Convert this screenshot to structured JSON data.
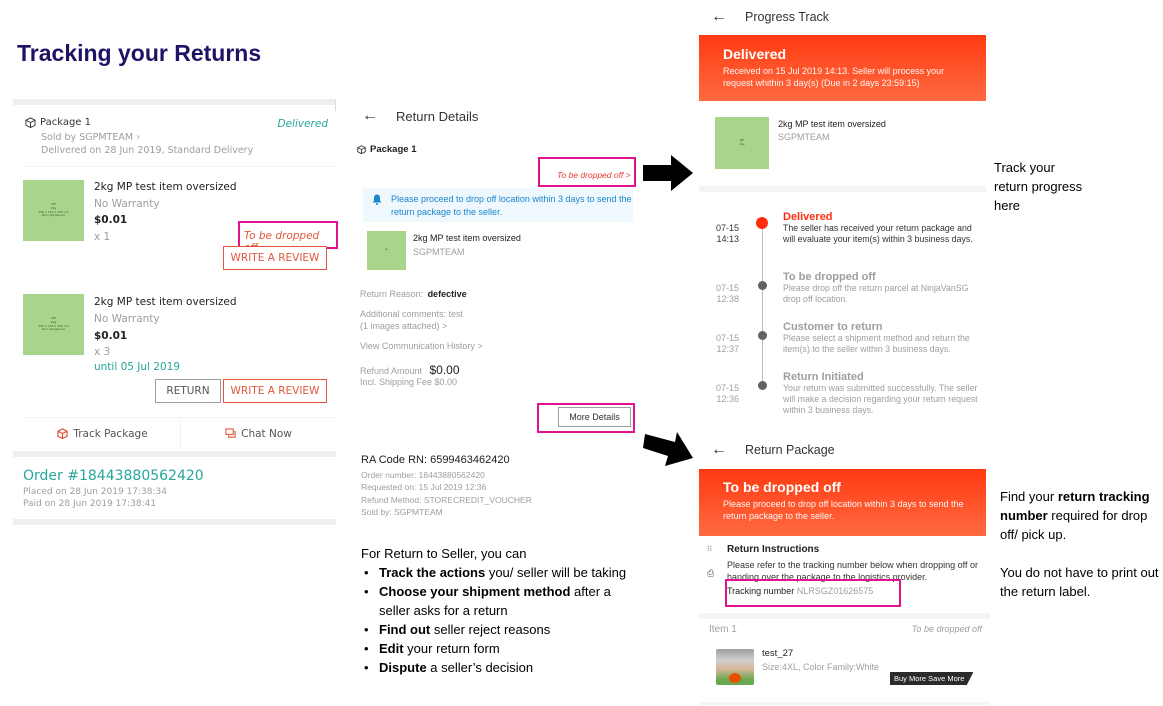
{
  "page_title": "Tracking your Returns",
  "orders_panel": {
    "package_label": "Package 1",
    "package_status": "Delivered",
    "sold_by": "Sold by SGPMTEAM",
    "delivered_on": "Delivered on 28 Jun 2019, Standard Delivery",
    "items": [
      {
        "image_text": [
          "MP",
          "2kg",
          "150 x 150 x 150 cm",
          "Non-dangerous"
        ],
        "name": "2kg MP test item oversized",
        "warranty": "No Warranty",
        "price": "$0.01",
        "qty": "x 1",
        "status": "To be dropped off",
        "review_label": "WRITE A REVIEW"
      },
      {
        "image_text": [
          "MP",
          "2kg",
          "150 x 150 x 150 cm",
          "Non-dangerous"
        ],
        "name": "2kg MP test item oversized",
        "warranty": "No Warranty",
        "price": "$0.01",
        "qty": "x 3",
        "return_until": "until  05 Jul 2019",
        "return_label": "RETURN",
        "review_label": "WRITE A REVIEW"
      }
    ],
    "track_package": "Track Package",
    "chat_now": "Chat Now",
    "order_number": "Order #18443880562420",
    "placed_on": "Placed on 28 Jun 2019  17:38:34",
    "paid_on": "Paid on 28 Jun 2019  17:38:41"
  },
  "return_details": {
    "title": "Return Details",
    "package_label": "Package 1",
    "status_link": "To be dropped off >",
    "notice": "Please proceed to drop off location within 3 days to send the return package to the seller.",
    "item_name": "2kg MP test item oversized",
    "item_seller": "SGPMTEAM",
    "reason_label": "Return Reason:",
    "reason_value": "defective",
    "comments": "Additional comments: test",
    "images_attached": "(1 images attached)  >",
    "communication_history": "View Communication History  >",
    "refund_label": "Refund Amount",
    "refund_value": "$0.00",
    "shipping_fee": "Incl. Shipping Fee $0.00",
    "more_details": "More Details",
    "ra_code": "RA Code RN: 6599463462420",
    "order_number": "Order number: 18443880562420",
    "requested_on": "Requested on: 15 Jul 2019 12:36",
    "refund_method": "Refund Method: STORECREDIT_VOUCHER",
    "sold_by": "Sold by: SGPMTEAM"
  },
  "guide": {
    "intro": "For Return to Seller, you can",
    "bullets": [
      {
        "bold": "Track the actions",
        "rest": " you/ seller will be taking"
      },
      {
        "bold": "Choose your shipment method",
        "rest": " after a seller asks for a return"
      },
      {
        "bold": "Find out",
        "rest": " seller reject reasons"
      },
      {
        "bold": "Edit",
        "rest": " your return  form"
      },
      {
        "bold": "Dispute",
        "rest": " a seller’s decision"
      }
    ]
  },
  "progress_track": {
    "title": "Progress Track",
    "banner_title": "Delivered",
    "banner_text": "Received on 15 Jul 2019 14:13. Seller will process your request whithin 3 day(s) (Due in 2 days 23:59:15)",
    "item_name": "2kg MP test item oversized",
    "item_seller": "SGPMTEAM",
    "timeline": [
      {
        "date": "07-15",
        "time": "14:13",
        "title": "Delivered",
        "desc": "The seller has received your return package and will evaluate your item(s) within 3 business days.",
        "active": true
      },
      {
        "date": "07-15",
        "time": "12:38",
        "title": "To be dropped off",
        "desc": "Please drop off the return parcel at NinjaVanSG drop off location.",
        "active": false
      },
      {
        "date": "07-15",
        "time": "12:37",
        "title": "Customer to return",
        "desc": "Please select a shipment method and return the item(s) to the seller within 3 business days.",
        "active": false
      },
      {
        "date": "07-15",
        "time": "12:36",
        "title": "Return Initiated",
        "desc": "Your return was submitted successfully. The seller will make a decision regarding your return request within 3 business days.",
        "active": false
      }
    ],
    "note": [
      "Track your",
      "return progress",
      "here"
    ]
  },
  "return_package": {
    "title": "Return Package",
    "banner_title": "To be dropped off",
    "banner_text": "Please proceed to drop off location within 3 days to send the return package to the seller.",
    "instructions_title": "Return Instructions",
    "instructions_text": "Please refer to the tracking number below when dropping off or handing over the package to the logistics provider.",
    "tracking_label": "Tracking number",
    "tracking_number": "NLRSGZ01626575",
    "item_label": "Item 1",
    "item_status": "To be dropped off",
    "item_name": "test_27",
    "item_variant": "Size:4XL, Color Family:White",
    "promo_tag": "Buy More Save More",
    "note_line1": "Find your ",
    "note_bold": "return tracking number",
    "note_line2": " required for drop off/ pick up.",
    "note_para2": "You do not have to print out the return label."
  },
  "colors": {
    "title": "#1d1465",
    "accent_orange": "#ff3a12",
    "teal": "#26a69a",
    "highlight": "#e0138c",
    "review_red": "#e0573b",
    "notice_blue": "#1a86d0"
  }
}
